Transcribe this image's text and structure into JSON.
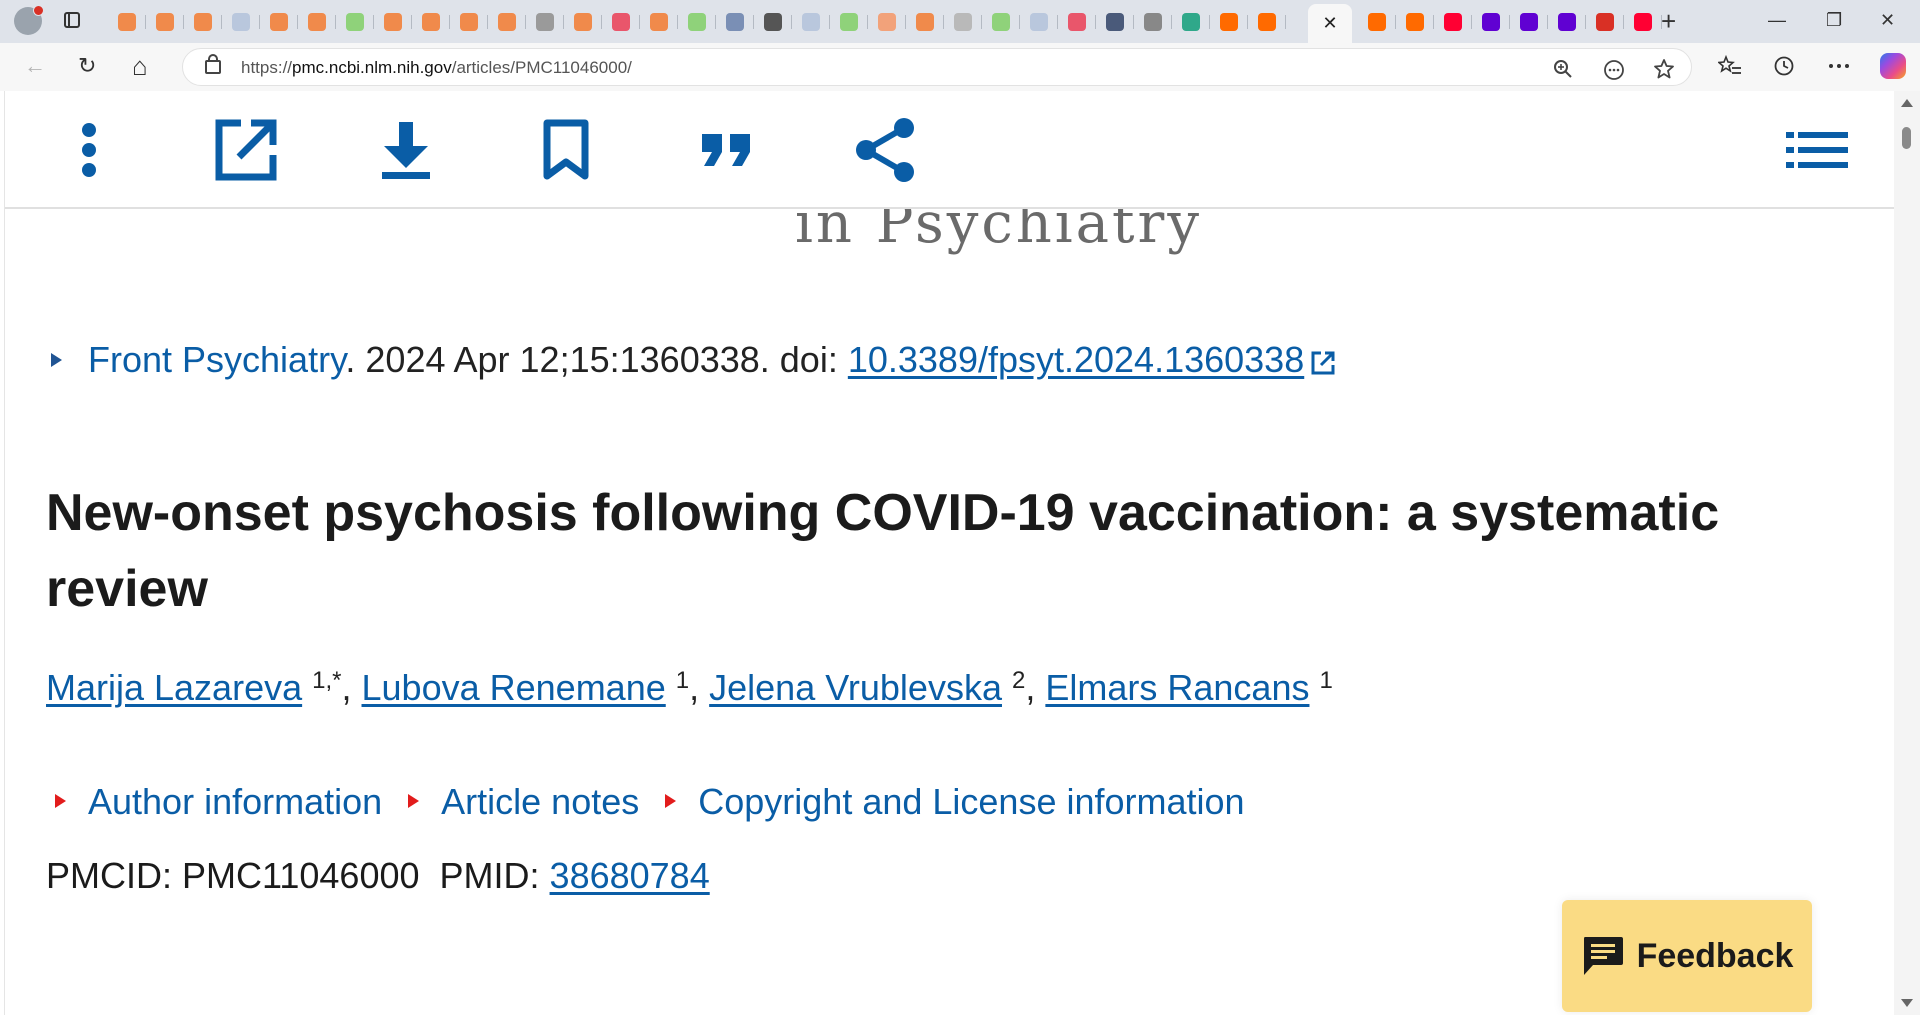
{
  "browser": {
    "url_prefix": "https://",
    "url_host": "pmc.ncbi.nlm.nih.gov",
    "url_path": "/articles/PMC11046000/",
    "active_tab_close": "✕",
    "new_tab": "+",
    "window_controls": {
      "minimize": "—",
      "restore": "❐",
      "close": "✕"
    },
    "nav": {
      "back": "←",
      "reload": "↻",
      "home": "⌂"
    },
    "tab_favicon_colors": [
      "#f08a4b",
      "#f08a4b",
      "#f08a4b",
      "#b9c7dd",
      "#f08a4b",
      "#f08a4b",
      "#8fd27a",
      "#f08a4b",
      "#f08a4b",
      "#f08a4b",
      "#f08a4b",
      "#9a9a9a",
      "#f08a4b",
      "#e9566b",
      "#f08a4b",
      "#8fd27a",
      "#7a8fb5",
      "#555555",
      "#b9c7dd",
      "#8fd27a",
      "#f2a27a",
      "#f08a4b",
      "#b9b9b9",
      "#8fd27a",
      "#b9c7dd",
      "#e9566b",
      "#4a5a7a",
      "#888888",
      "#2fa88a",
      "#ff6a00",
      "#ff6a00"
    ],
    "active_group_favicon_colors": [
      "#ff6a00",
      "#ff6a00",
      "#ff0033",
      "#6001d2",
      "#6001d2",
      "#6001d2",
      "#d93025",
      "#ff0033"
    ]
  },
  "article_toolbar": {
    "icons": [
      "more-vertical-icon",
      "open-external-icon",
      "download-icon",
      "bookmark-icon",
      "cite-quote-icon",
      "share-icon",
      "list-icon"
    ]
  },
  "journal_banner_fragment": "in Psychiatry",
  "citation": {
    "journal": "Front Psychiatry",
    "details": ". 2024 Apr 12;15:1360338. doi: ",
    "doi": "10.3389/fpsyt.2024.1360338"
  },
  "title": "New-onset psychosis following COVID-19 vaccination: a systematic review",
  "authors": [
    {
      "name": "Marija Lazareva",
      "aff": "1,*"
    },
    {
      "name": "Lubova Renemane",
      "aff": "1"
    },
    {
      "name": "Jelena Vrublevska",
      "aff": "2"
    },
    {
      "name": "Elmars Rancans",
      "aff": "1"
    }
  ],
  "author_separator": ", ",
  "accordions": [
    "Author information",
    "Article notes",
    "Copyright and License information"
  ],
  "ids": {
    "pmcid_label": "PMCID: ",
    "pmcid": "PMC11046000",
    "pmid_label": "PMID: ",
    "pmid": "38680784"
  },
  "feedback": {
    "label": "Feedback"
  },
  "colors": {
    "link": "#0a5da6",
    "toolbar_icon": "#0a5da6",
    "accordion_marker": "#e21c1c",
    "feedback_bg": "#fadb84"
  }
}
